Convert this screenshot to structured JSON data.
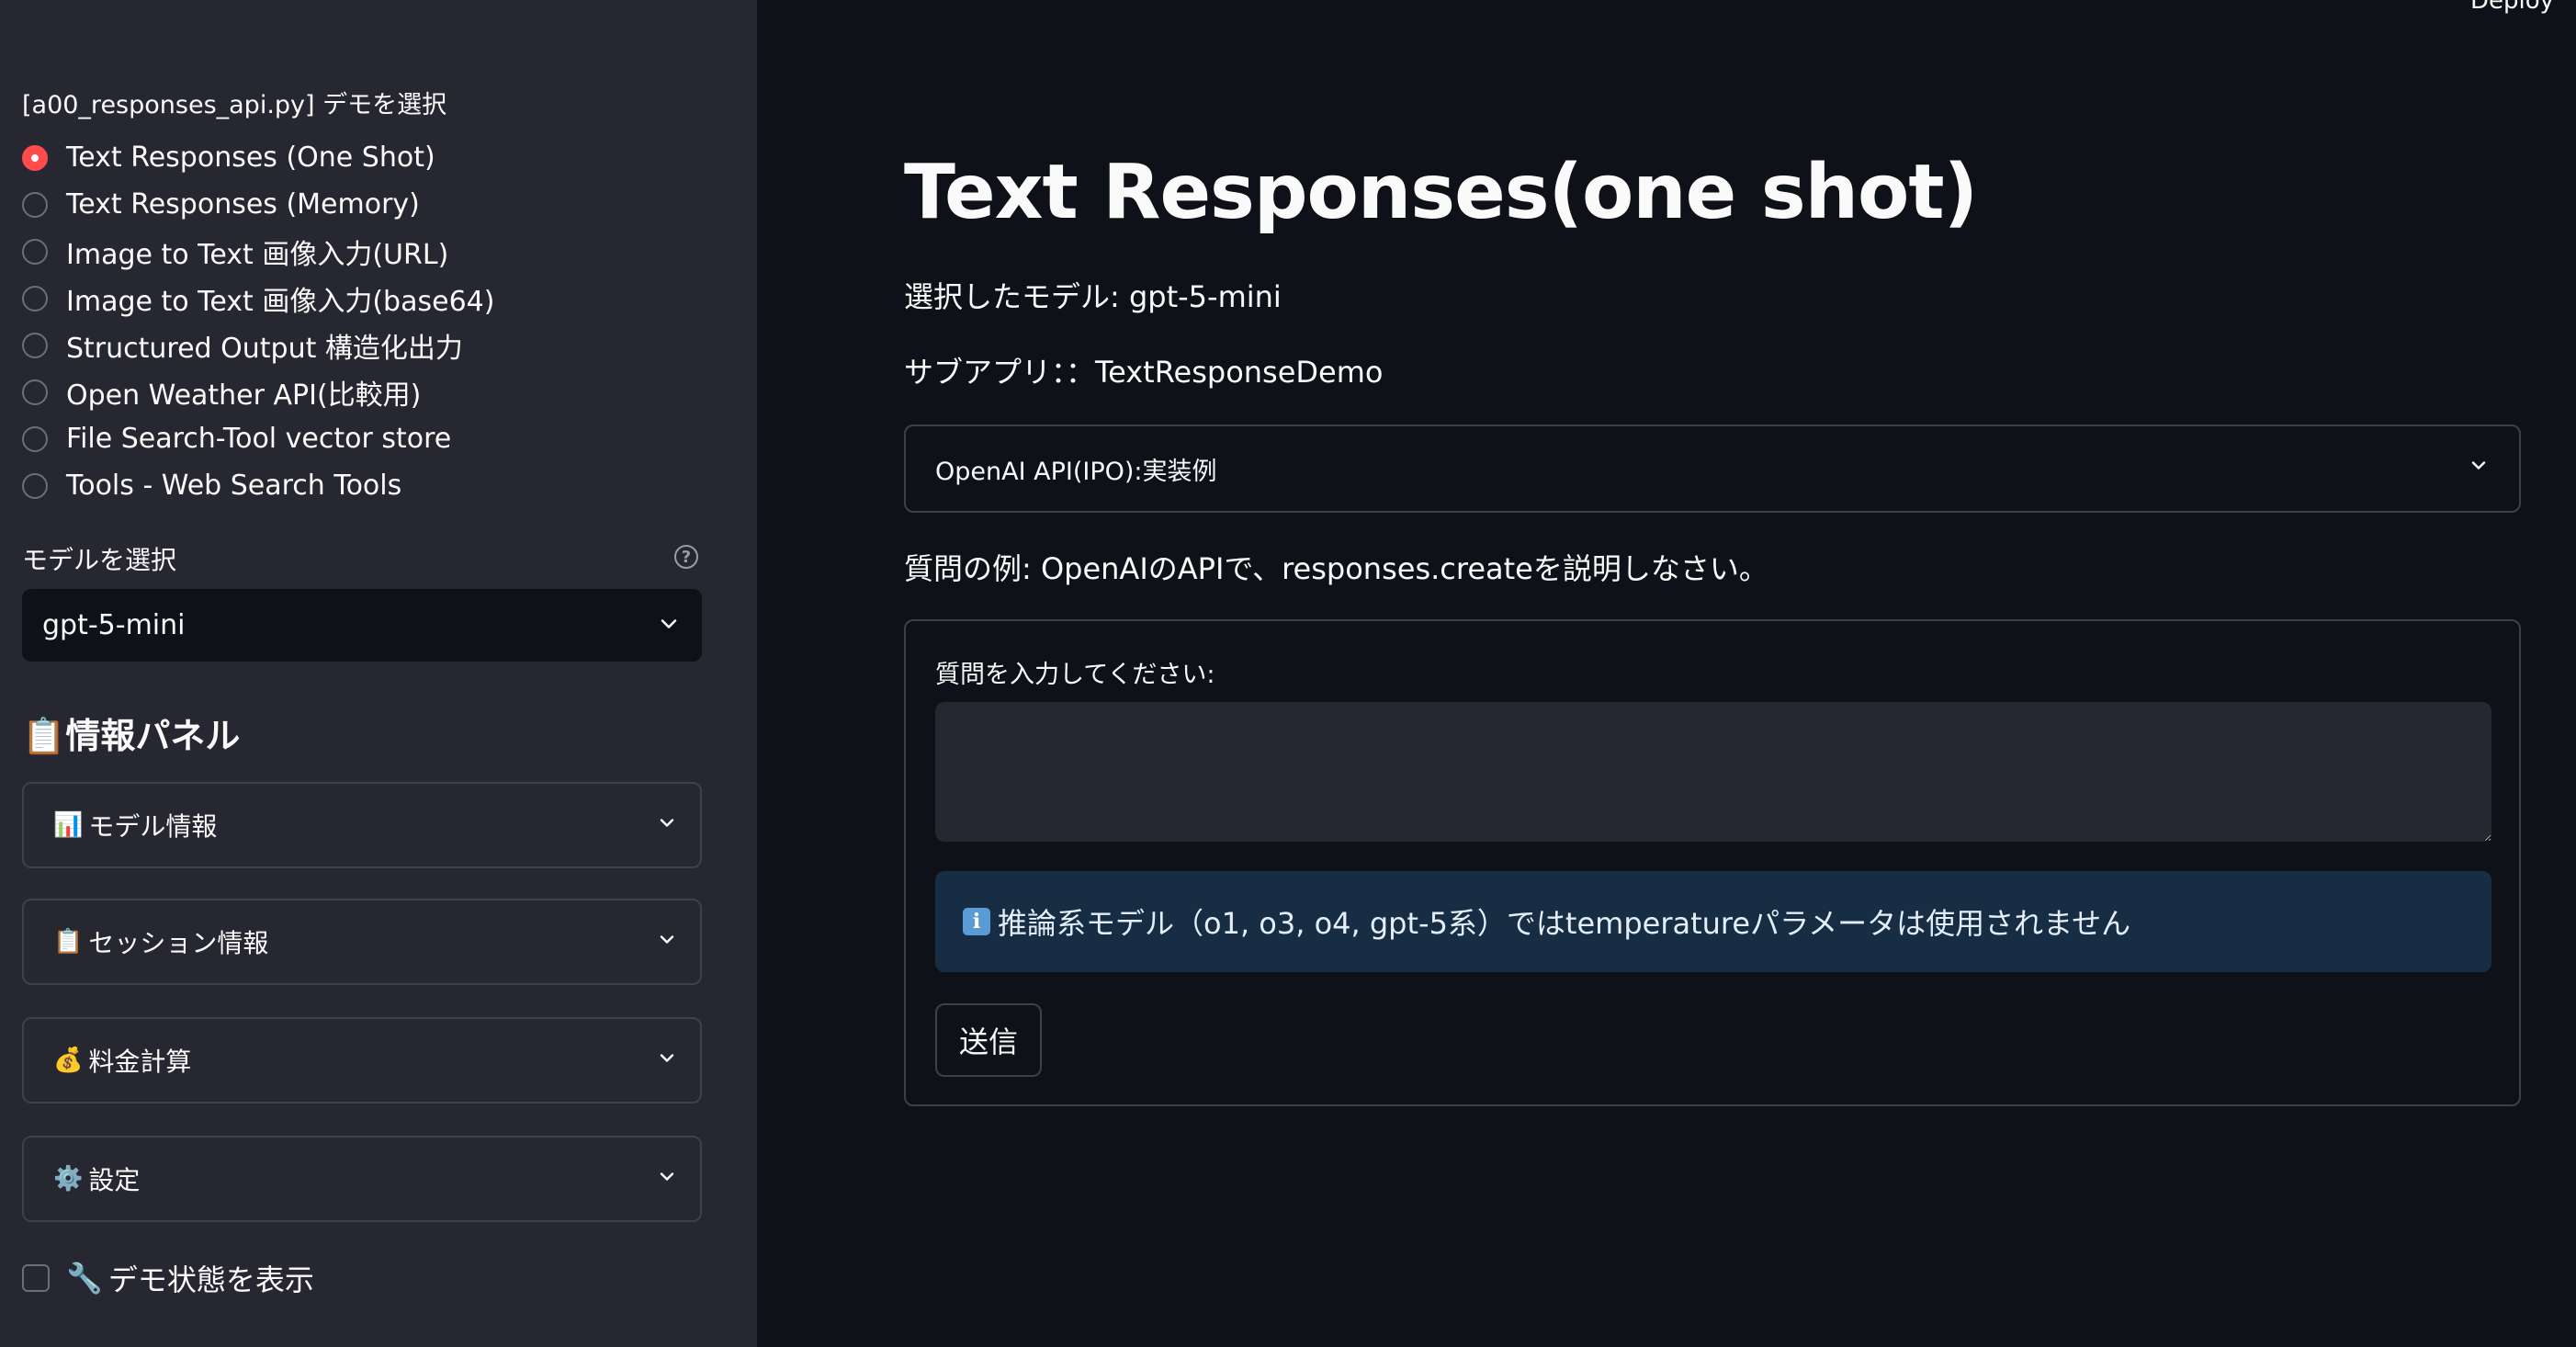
{
  "sidebar": {
    "radio_title": "[a00_responses_api.py] デモを選択",
    "radio_options": [
      {
        "label": "Text Responses (One Shot)",
        "selected": true
      },
      {
        "label": "Text Responses (Memory)",
        "selected": false
      },
      {
        "label": "Image to Text 画像入力(URL)",
        "selected": false
      },
      {
        "label": "Image to Text 画像入力(base64)",
        "selected": false
      },
      {
        "label": "Structured Output 構造化出力",
        "selected": false
      },
      {
        "label": "Open Weather API(比較用)",
        "selected": false
      },
      {
        "label": "File Search-Tool vector store",
        "selected": false
      },
      {
        "label": "Tools - Web Search Tools",
        "selected": false
      }
    ],
    "model_label": "モデルを選択",
    "help_icon": "?",
    "model_value": "gpt-5-mini",
    "panel_heading_icon": "📋",
    "panel_heading": "情報パネル",
    "expanders": [
      {
        "icon": "📊",
        "label": "モデル情報"
      },
      {
        "icon": "📋",
        "label": "セッション情報"
      },
      {
        "icon": "💰",
        "label": "料金計算"
      },
      {
        "icon": "⚙️",
        "label": "設定"
      }
    ],
    "checkbox_icon": "🔧",
    "checkbox_label": "デモ状態を表示",
    "checkbox_checked": false
  },
  "header": {
    "deploy_label": "Deploy"
  },
  "main": {
    "title": "Text Responses(one shot)",
    "selected_model_text": "選択したモデル: gpt-5-mini",
    "subapp_text": "サブアプリ：：TextResponseDemo",
    "expander_label": "OpenAI API(IPO):実装例",
    "question_example": "質問の例: OpenAIのAPIで、responses.createを説明しなさい。",
    "form": {
      "input_label": "質問を入力してください:",
      "input_value": "",
      "alert_icon": "i",
      "alert_text": "推論系モデル（o1, o3, o4, gpt-5系）ではtemperatureパラメータは使用されません",
      "submit_label": "送信"
    }
  },
  "colors": {
    "accent": "#ff4b4b",
    "sidebar_bg": "#262730",
    "main_bg": "#0e1117",
    "alert_bg": "#172d43"
  }
}
